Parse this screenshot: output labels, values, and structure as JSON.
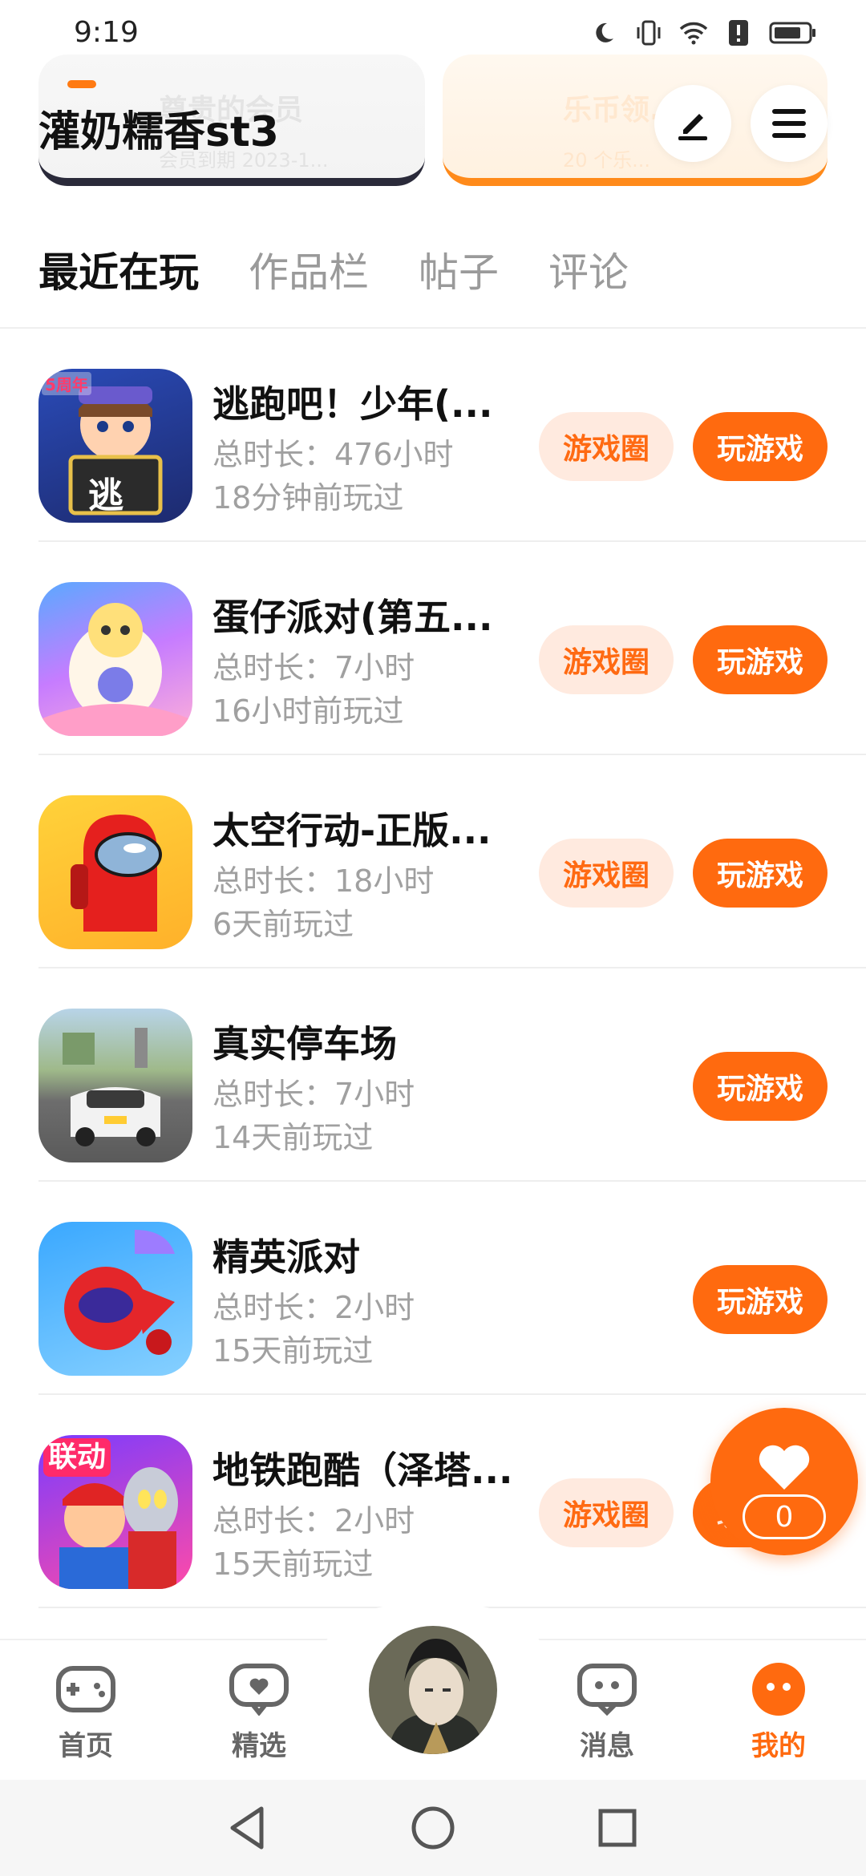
{
  "status_bar": {
    "time": "9:19",
    "icons": [
      "moon-icon",
      "vibrate-icon",
      "wifi-icon",
      "alert-icon",
      "battery-icon"
    ]
  },
  "header": {
    "username": "灌奶糯香st3",
    "member_card_faint_title": "尊贵的会员",
    "member_card_faint_sub": "会员到期 2023-1...",
    "coin_card_faint_title": "乐币领...",
    "coin_card_faint_sub": "20 个乐..."
  },
  "tabs": [
    {
      "label": "最近在玩",
      "active": true
    },
    {
      "label": "作品栏",
      "active": false
    },
    {
      "label": "帖子",
      "active": false
    },
    {
      "label": "评论",
      "active": false
    }
  ],
  "buttons": {
    "circle": "游戏圈",
    "play": "玩游戏"
  },
  "games": [
    {
      "title": "逃跑吧！少年(...",
      "duration": "总时长：476小时",
      "last_played": "18分钟前玩过",
      "has_circle": true
    },
    {
      "title": "蛋仔派对(第五...",
      "duration": "总时长：7小时",
      "last_played": "16小时前玩过",
      "has_circle": true
    },
    {
      "title": "太空行动-正版...",
      "duration": "总时长：18小时",
      "last_played": "6天前玩过",
      "has_circle": true
    },
    {
      "title": "真实停车场",
      "duration": "总时长：7小时",
      "last_played": "14天前玩过",
      "has_circle": false
    },
    {
      "title": "精英派对",
      "duration": "总时长：2小时",
      "last_played": "15天前玩过",
      "has_circle": false
    },
    {
      "title": "地铁跑酷（泽塔...",
      "duration": "总时长：2小时",
      "last_played": "15天前玩过",
      "has_circle": true
    }
  ],
  "icon_labels": {
    "game1_badge": "逃",
    "game1_ribbon": "5周年",
    "game6_badge": "联动"
  },
  "fab": {
    "count": "0"
  },
  "bottom_nav": [
    {
      "label": "首页",
      "icon": "gamepad-icon",
      "active": false
    },
    {
      "label": "精选",
      "icon": "heart-chat-icon",
      "active": false
    },
    {
      "label": "消息",
      "icon": "message-icon",
      "active": false
    },
    {
      "label": "我的",
      "icon": "profile-face-icon",
      "active": true
    }
  ],
  "colors": {
    "accent": "#ff6a0f",
    "circle_bg": "#ffeadf",
    "muted_text": "#a0a0a0"
  }
}
